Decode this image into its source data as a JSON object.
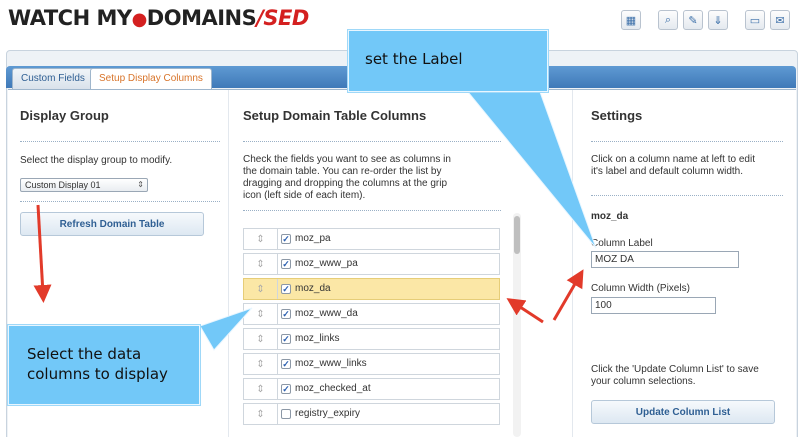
{
  "header": {
    "logo_part1": "WATCH MY",
    "logo_dot": "●",
    "logo_part2": "DOMAINS",
    "logo_part3": "/SED",
    "toolbar_icons": [
      "grid-icon",
      "search-doc-icon",
      "tools-icon",
      "download-icon",
      "folder-icon",
      "mail-icon"
    ]
  },
  "tabs": [
    {
      "label": "Custom Fields"
    },
    {
      "label": "Setup Display Columns"
    }
  ],
  "left": {
    "title": "Display Group",
    "instruction": "Select the display group to modify.",
    "select_value": "Custom Display 01",
    "refresh_button": "Refresh Domain Table"
  },
  "middle": {
    "title": "Setup Domain Table Columns",
    "instruction_lines": [
      "Check the fields you want to see as columns in",
      "the domain table. You can re-order the list by",
      "dragging and dropping the columns at the grip",
      "icon (left side of each item)."
    ],
    "rows": [
      {
        "label": "moz_pa",
        "checked": true
      },
      {
        "label": "moz_www_pa",
        "checked": true
      },
      {
        "label": "moz_da",
        "checked": true
      },
      {
        "label": "moz_www_da",
        "checked": true
      },
      {
        "label": "moz_links",
        "checked": true
      },
      {
        "label": "moz_www_links",
        "checked": true
      },
      {
        "label": "moz_checked_at",
        "checked": true
      },
      {
        "label": "registry_expiry",
        "checked": false
      }
    ]
  },
  "right": {
    "title": "Settings",
    "instruction_lines": [
      "Click on a column name at left to edit",
      "it's label and default column width."
    ],
    "selected_field": "moz_da",
    "label_caption": "Column Label",
    "label_value": "MOZ DA",
    "width_caption": "Column Width (Pixels)",
    "width_value": "100",
    "update_note_lines": [
      "Click the 'Update Column List' to save",
      "your column selections."
    ],
    "update_button": "Update Column List"
  },
  "callouts": {
    "top": "set the Label",
    "bottom_line1": "Select the data",
    "bottom_line2": "columns to display"
  },
  "colors": {
    "callout": "#72c8f8",
    "arrow": "#e23a2a",
    "highlight": "#fbe7a6",
    "tab_active_text": "#d8742a"
  }
}
